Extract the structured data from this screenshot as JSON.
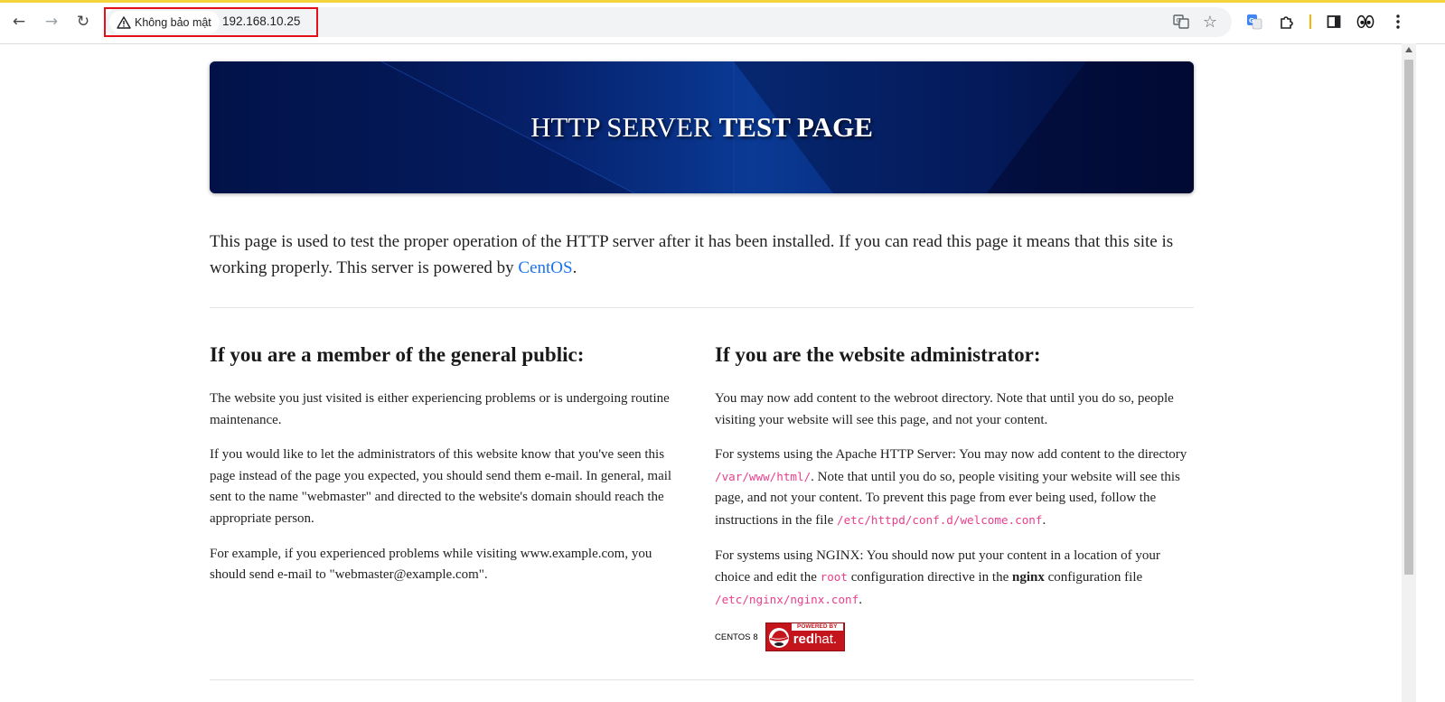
{
  "browser": {
    "security_label": "Không bảo mật",
    "url": "192.168.10.25"
  },
  "page": {
    "banner": {
      "title_normal": "HTTP SERVER",
      "title_bold": "TEST PAGE"
    },
    "intro": {
      "text": "This page is used to test the proper operation of the HTTP server after it has been installed. If you can read this page it means that this site is working properly. This server is powered by ",
      "link": "CentOS",
      "end": "."
    },
    "public": {
      "heading": "If you are a member of the general public:",
      "p1": "The website you just visited is either experiencing problems or is undergoing routine maintenance.",
      "p2": "If you would like to let the administrators of this website know that you've seen this page instead of the page you expected, you should send them e-mail. In general, mail sent to the name \"webmaster\" and directed to the website's domain should reach the appropriate person.",
      "p3": "For example, if you experienced problems while visiting www.example.com, you should send e-mail to \"webmaster@example.com\"."
    },
    "admin": {
      "heading": "If you are the website administrator:",
      "p1": "You may now add content to the webroot directory. Note that until you do so, people visiting your website will see this page, and not your content.",
      "p2_a": "For systems using the Apache HTTP Server: You may now add content to the directory ",
      "p2_code1": "/var/www/html/",
      "p2_b": ". Note that until you do so, people visiting your website will see this page, and not your content. To prevent this page from ever being used, follow the instructions in the file ",
      "p2_code2": "/etc/httpd/conf.d/welcome.conf",
      "p2_c": ".",
      "p3_a": "For systems using NGINX: You should now put your content in a location of your choice and edit the ",
      "p3_code1": "root",
      "p3_b": " configuration directive in the ",
      "p3_bold": "nginx",
      "p3_c": " configuration file ",
      "p3_code2": "/etc/nginx/nginx.conf",
      "p3_d": "."
    },
    "logos": {
      "centos": "CENTOS",
      "centos_version": "8",
      "powered_by": "POWERED BY",
      "redhat_bold": "red",
      "redhat_normal": "hat."
    }
  }
}
